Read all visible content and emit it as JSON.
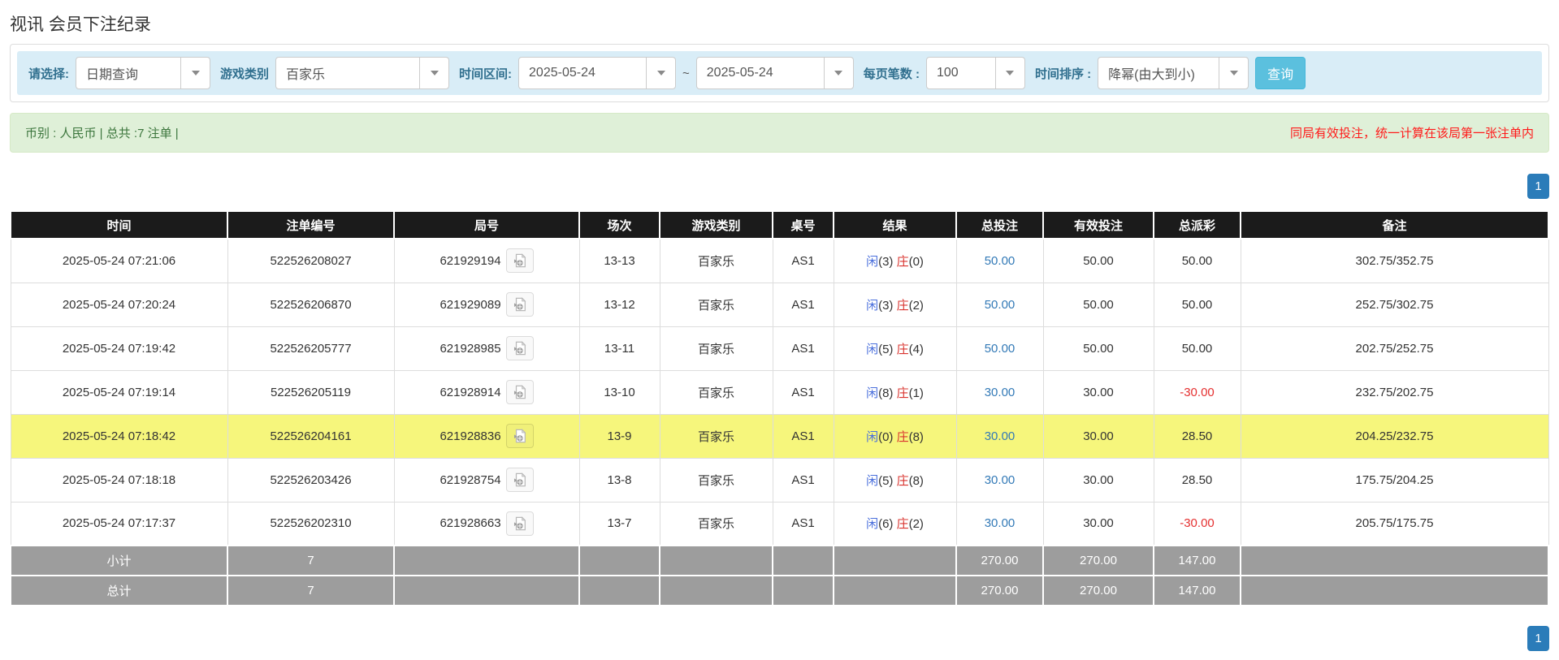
{
  "colors": {
    "accent_blue": "#5bc0de",
    "link_blue": "#337ab7",
    "player_blue": "#4a6fdc",
    "banker_red": "#d9342f",
    "loss_red": "#e53030",
    "highlight_yellow": "#f6f67c",
    "pager_blue": "#2b7cb9",
    "header_bg": "#1b1b1b",
    "footer_bg": "#9d9d9d",
    "filter_bg": "#d9edf7",
    "summary_bg": "#dff0d8",
    "summary_text": "#3c763d",
    "notice_red": "#ff1a1a",
    "label_blue": "#31708f"
  },
  "page": {
    "title": "视讯 会员下注纪录"
  },
  "filters": {
    "select_type": {
      "label": "请选择:",
      "value": "日期查询"
    },
    "game_category": {
      "label": "游戏类别",
      "value": "百家乐"
    },
    "time_range": {
      "label": "时间区间:",
      "from": "2025-05-24",
      "separator": "~",
      "to": "2025-05-24"
    },
    "page_size": {
      "label": "每页笔数 :",
      "value": "100"
    },
    "time_sort": {
      "label": "时间排序 :",
      "value": "降幂(由大到小)"
    },
    "search_button": "查询"
  },
  "summary": {
    "info": "币别 : 人民币 | 总共 :7 注单 |",
    "notice": "同局有效投注，统一计算在该局第一张注单内"
  },
  "pagination": {
    "top": "1",
    "bottom": "1"
  },
  "table": {
    "columns": [
      "时间",
      "注单编号",
      "局号",
      "场次",
      "游戏类别",
      "桌号",
      "结果",
      "总投注",
      "有效投注",
      "总派彩",
      "备注"
    ],
    "result_labels": {
      "player": "闲",
      "banker": "庄"
    },
    "rows": [
      {
        "time": "2025-05-24 07:21:06",
        "bet_id": "522526208027",
        "round_id": "621929194",
        "session": "13-13",
        "game": "百家乐",
        "table_no": "AS1",
        "result": {
          "player": 3,
          "banker": 0
        },
        "total_bet": "50.00",
        "valid_bet": "50.00",
        "payout": "50.00",
        "note": "302.75/352.75",
        "highlighted": false
      },
      {
        "time": "2025-05-24 07:20:24",
        "bet_id": "522526206870",
        "round_id": "621929089",
        "session": "13-12",
        "game": "百家乐",
        "table_no": "AS1",
        "result": {
          "player": 3,
          "banker": 2
        },
        "total_bet": "50.00",
        "valid_bet": "50.00",
        "payout": "50.00",
        "note": "252.75/302.75",
        "highlighted": false
      },
      {
        "time": "2025-05-24 07:19:42",
        "bet_id": "522526205777",
        "round_id": "621928985",
        "session": "13-11",
        "game": "百家乐",
        "table_no": "AS1",
        "result": {
          "player": 5,
          "banker": 4
        },
        "total_bet": "50.00",
        "valid_bet": "50.00",
        "payout": "50.00",
        "note": "202.75/252.75",
        "highlighted": false
      },
      {
        "time": "2025-05-24 07:19:14",
        "bet_id": "522526205119",
        "round_id": "621928914",
        "session": "13-10",
        "game": "百家乐",
        "table_no": "AS1",
        "result": {
          "player": 8,
          "banker": 1
        },
        "total_bet": "30.00",
        "valid_bet": "30.00",
        "payout": "-30.00",
        "note": "232.75/202.75",
        "highlighted": false
      },
      {
        "time": "2025-05-24 07:18:42",
        "bet_id": "522526204161",
        "round_id": "621928836",
        "session": "13-9",
        "game": "百家乐",
        "table_no": "AS1",
        "result": {
          "player": 0,
          "banker": 8
        },
        "total_bet": "30.00",
        "valid_bet": "30.00",
        "payout": "28.50",
        "note": "204.25/232.75",
        "highlighted": true
      },
      {
        "time": "2025-05-24 07:18:18",
        "bet_id": "522526203426",
        "round_id": "621928754",
        "session": "13-8",
        "game": "百家乐",
        "table_no": "AS1",
        "result": {
          "player": 5,
          "banker": 8
        },
        "total_bet": "30.00",
        "valid_bet": "30.00",
        "payout": "28.50",
        "note": "175.75/204.25",
        "highlighted": false
      },
      {
        "time": "2025-05-24 07:17:37",
        "bet_id": "522526202310",
        "round_id": "621928663",
        "session": "13-7",
        "game": "百家乐",
        "table_no": "AS1",
        "result": {
          "player": 6,
          "banker": 2
        },
        "total_bet": "30.00",
        "valid_bet": "30.00",
        "payout": "-30.00",
        "note": "205.75/175.75",
        "highlighted": false
      }
    ],
    "footer": [
      {
        "label": "小计",
        "count": "7",
        "total_bet": "270.00",
        "valid_bet": "270.00",
        "payout": "147.00"
      },
      {
        "label": "总计",
        "count": "7",
        "total_bet": "270.00",
        "valid_bet": "270.00",
        "payout": "147.00"
      }
    ]
  }
}
